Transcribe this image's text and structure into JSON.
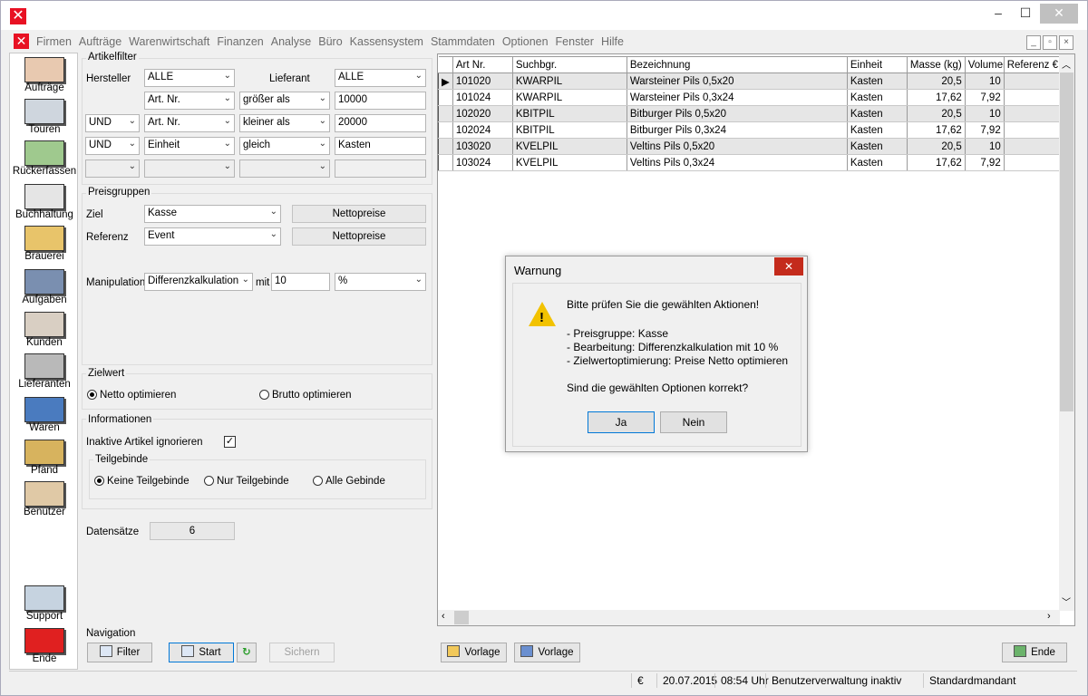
{
  "window": {
    "min": "–",
    "max": "☐",
    "close": "✕"
  },
  "menu": [
    "Firmen",
    "Aufträge",
    "Warenwirtschaft",
    "Finanzen",
    "Analyse",
    "Büro",
    "Kassensystem",
    "Stammdaten",
    "Optionen",
    "Fenster",
    "Hilfe"
  ],
  "sidebar": [
    "Aufträge",
    "Touren",
    "Rückerfassen",
    "Buchhaltung",
    "Brauerei",
    "Aufgaben",
    "Kunden",
    "Lieferanten",
    "Waren",
    "Pfand",
    "Benutzer",
    "Support",
    "Ende"
  ],
  "filter": {
    "title": "Artikelfilter",
    "hersteller_label": "Hersteller",
    "hersteller": "ALLE",
    "lieferant_label": "Lieferant",
    "lieferant": "ALLE",
    "rows": [
      {
        "logic": "",
        "field": "Art. Nr.",
        "op": "größer als",
        "value": "10000"
      },
      {
        "logic": "UND",
        "field": "Art. Nr.",
        "op": "kleiner als",
        "value": "20000"
      },
      {
        "logic": "UND",
        "field": "Einheit",
        "op": "gleich",
        "value": "Kasten"
      },
      {
        "logic": "",
        "field": "",
        "op": "",
        "value": ""
      }
    ]
  },
  "preis": {
    "title": "Preisgruppen",
    "ziel_label": "Ziel",
    "ziel": "Kasse",
    "ziel_btn": "Nettopreise",
    "ref_label": "Referenz",
    "ref": "Event",
    "ref_btn": "Nettopreise",
    "manip_label": "Manipulation",
    "manip": "Differenzkalkulation",
    "mit_label": "mit",
    "mit_value": "10",
    "unit": "%"
  },
  "zielwert": {
    "title": "Zielwert",
    "netto": "Netto optimieren",
    "brutto": "Brutto optimieren"
  },
  "info": {
    "title": "Informationen",
    "inaktive_label": "Inaktive Artikel ignorieren",
    "teil_title": "Teilgebinde",
    "keine": "Keine Teilgebinde",
    "nur": "Nur Teilgebinde",
    "alle": "Alle Gebinde"
  },
  "datensaetze": {
    "label": "Datensätze",
    "value": "6"
  },
  "grid": {
    "headers": [
      "Art Nr.",
      "Suchbgr.",
      "Bezeichnung",
      "Einheit",
      "Masse (kg)",
      "Volumen",
      "Referenz €"
    ],
    "rows": [
      [
        "101020",
        "KWARPIL",
        "Warsteiner Pils 0,5x20",
        "Kasten",
        "20,5",
        "10",
        ""
      ],
      [
        "101024",
        "KWARPIL",
        "Warsteiner Pils 0,3x24",
        "Kasten",
        "17,62",
        "7,92",
        ""
      ],
      [
        "102020",
        "KBITPIL",
        "Bitburger Pils 0,5x20",
        "Kasten",
        "20,5",
        "10",
        ""
      ],
      [
        "102024",
        "KBITPIL",
        "Bitburger Pils 0,3x24",
        "Kasten",
        "17,62",
        "7,92",
        ""
      ],
      [
        "103020",
        "KVELPIL",
        "Veltins Pils 0,5x20",
        "Kasten",
        "20,5",
        "10",
        ""
      ],
      [
        "103024",
        "KVELPIL",
        "Veltins Pils 0,3x24",
        "Kasten",
        "17,62",
        "7,92",
        ""
      ]
    ]
  },
  "nav": {
    "title": "Navigation",
    "filter": "Filter",
    "start": "Start",
    "sichern": "Sichern",
    "vorlage1": "Vorlage",
    "vorlage2": "Vorlage",
    "ende": "Ende"
  },
  "status": {
    "currency": "€",
    "date": "20.07.2015",
    "time": "08:54 Uhr",
    "user": "Benutzerverwaltung inaktiv",
    "mandant": "Standardmandant"
  },
  "dialog": {
    "title": "Warnung",
    "line1": "Bitte prüfen Sie die gewählten Aktionen!",
    "line2": "- Preisgruppe: Kasse",
    "line3": "- Bearbeitung: Differenzkalkulation mit 10 %",
    "line4": "- Zielwertoptimierung: Preise Netto optimieren",
    "line5": "Sind die gewählten Optionen korrekt?",
    "ja": "Ja",
    "nein": "Nein"
  }
}
